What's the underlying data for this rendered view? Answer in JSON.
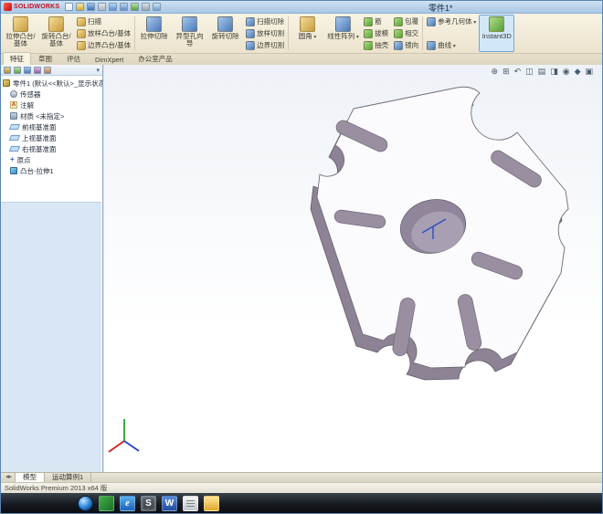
{
  "window": {
    "brand": "SOLIDWORKS",
    "title": "零件1*"
  },
  "quick_access": {
    "icons": [
      "new-document",
      "open",
      "save",
      "print",
      "undo",
      "redo",
      "rebuild",
      "options",
      "help"
    ]
  },
  "ribbon": {
    "tabs": [
      {
        "label": "特征",
        "active": true
      },
      {
        "label": "草图",
        "active": false
      },
      {
        "label": "评估",
        "active": false
      },
      {
        "label": "DimXpert",
        "active": false
      },
      {
        "label": "办公室产品",
        "active": false
      }
    ],
    "buttons": [
      {
        "label": "拉伸凸台/基体",
        "type": "large",
        "color": "gold"
      },
      {
        "label": "旋转凸台/基体",
        "type": "large",
        "color": "gold"
      },
      {
        "label": "扫描",
        "type": "small",
        "color": "gold"
      },
      {
        "label": "放样凸台/基体",
        "type": "small",
        "color": "gold"
      },
      {
        "label": "边界凸台/基体",
        "type": "small",
        "color": "gold"
      },
      {
        "label": "拉伸切除",
        "type": "large",
        "color": "blue"
      },
      {
        "label": "异型孔向导",
        "type": "large",
        "color": "blue"
      },
      {
        "label": "旋转切除",
        "type": "large",
        "color": "blue"
      },
      {
        "label": "扫描切除",
        "type": "small",
        "color": "blue"
      },
      {
        "label": "放样切割",
        "type": "small",
        "color": "blue"
      },
      {
        "label": "边界切割",
        "type": "small",
        "color": "blue"
      },
      {
        "label": "圆角",
        "type": "large",
        "color": "gold",
        "arrow": true
      },
      {
        "label": "线性阵列",
        "type": "large",
        "color": "blue",
        "arrow": true
      },
      {
        "label": "筋",
        "type": "small",
        "color": "green"
      },
      {
        "label": "拔模",
        "type": "small",
        "color": "green"
      },
      {
        "label": "抽壳",
        "type": "small",
        "color": "green"
      },
      {
        "label": "包覆",
        "type": "small",
        "color": "green"
      },
      {
        "label": "相交",
        "type": "small",
        "color": "green"
      },
      {
        "label": "镜向",
        "type": "small",
        "color": "blue"
      },
      {
        "label": "参考几何体",
        "type": "small",
        "color": "blue",
        "arrow": true
      },
      {
        "label": "曲线",
        "type": "small",
        "color": "blue",
        "arrow": true
      },
      {
        "label": "Instant3D",
        "type": "large",
        "color": "green",
        "active": true
      }
    ]
  },
  "manager_tabs": {
    "icons": [
      "featuremanager",
      "propertymanager",
      "configurationmanager",
      "dimxpertmanager",
      "displaymanager"
    ]
  },
  "feature_tree": {
    "root": "零件1 (默认<<默认>_显示状态",
    "items": [
      {
        "label": "传感器",
        "icon": "sensors-icon"
      },
      {
        "label": "注解",
        "icon": "annotations-icon"
      },
      {
        "label": "材质 <未指定>",
        "icon": "material-icon"
      },
      {
        "label": "前视基准面",
        "icon": "plane-icon"
      },
      {
        "label": "上视基准面",
        "icon": "plane-icon"
      },
      {
        "label": "右视基准面",
        "icon": "plane-icon"
      },
      {
        "label": "原点",
        "icon": "origin-icon"
      },
      {
        "label": "凸台-拉伸1",
        "icon": "boss-extrude-tree-icon"
      }
    ]
  },
  "viewport": {
    "headsup": [
      {
        "name": "zoom-fit",
        "glyph": "⊕"
      },
      {
        "name": "zoom-area",
        "glyph": "⊞"
      },
      {
        "name": "previous-view",
        "glyph": "↶"
      },
      {
        "name": "section-view",
        "glyph": "◫"
      },
      {
        "name": "view-orientation",
        "glyph": "▤"
      },
      {
        "name": "display-style",
        "glyph": "◨"
      },
      {
        "name": "hide-show-items",
        "glyph": "◉"
      },
      {
        "name": "edit-appearance",
        "glyph": "◆"
      },
      {
        "name": "apply-scene",
        "glyph": "▣"
      }
    ],
    "model": {
      "face_color": "#fbfafc",
      "side_color": "#8e8295",
      "slot_color": "#9a8fa1",
      "hole_color": "#90859a",
      "edge_color": "#6e6d77",
      "origin_color": "#2b4fc0"
    },
    "triad": {
      "x_color": "#cc2222",
      "y_color": "#1fa32a",
      "z_color": "#2244cc"
    }
  },
  "bottom_tabs": {
    "tabs": [
      {
        "label": "模型",
        "active": true
      },
      {
        "label": "运动算例1",
        "active": false
      }
    ]
  },
  "status_bar": {
    "text": "SolidWorks Premium 2013 x64 版"
  },
  "taskbar": {
    "items": [
      {
        "name": "start"
      },
      {
        "name": "app-launcher",
        "letter": ""
      },
      {
        "name": "internet-explorer",
        "letter": "e"
      },
      {
        "name": "solidworks",
        "letter": "S",
        "active": true
      },
      {
        "name": "word",
        "letter": "W"
      },
      {
        "name": "notepad",
        "letter": ""
      },
      {
        "name": "folder",
        "letter": ""
      }
    ]
  }
}
